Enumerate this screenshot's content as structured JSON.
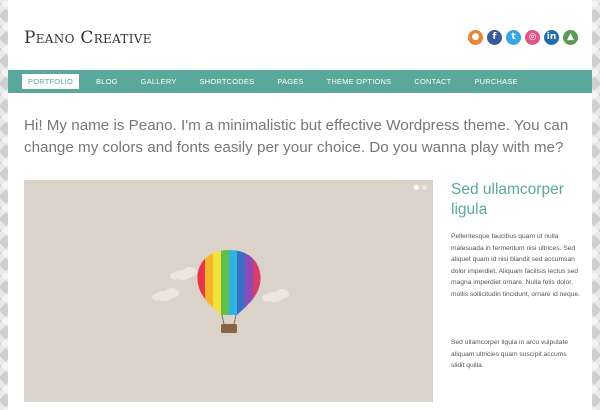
{
  "site": {
    "title": "Peano Creative"
  },
  "social": [
    {
      "icon": "rss-icon",
      "glyph": "●",
      "color": "#e8833a"
    },
    {
      "icon": "facebook-icon",
      "glyph": "f",
      "color": "#3b5998"
    },
    {
      "icon": "twitter-icon",
      "glyph": "t",
      "color": "#3aa7e0"
    },
    {
      "icon": "dribbble-icon",
      "glyph": "◎",
      "color": "#e2558c"
    },
    {
      "icon": "linkedin-icon",
      "glyph": "in",
      "color": "#1f6ea8"
    },
    {
      "icon": "forrst-icon",
      "glyph": "▲",
      "color": "#5a9a55"
    }
  ],
  "nav": {
    "items": [
      "Portfolio",
      "Blog",
      "Gallery",
      "Shortcodes",
      "Pages",
      "Theme Options",
      "Contact",
      "Purchase"
    ],
    "active_index": 0
  },
  "intro": "Hi! My name is Peano. I'm a minimalistic but effective Wordpress theme. You can change my colors and fonts easily per your choice. Do you wanna play with me?",
  "slider": {
    "slide_count": 2,
    "active_slide": 1
  },
  "sidebar": {
    "title": "Sed ullamcorper ligula",
    "p1": "Pellentesque faucibus quam ut nulla malesuada in fermentum nisi ultrices. Sed aliquet quam id nisi blandit sed accumsan dolor imperdiet. Aliquam facilisis lectus sed magna imperdiet ornare. Nulla felis dolor, mollis sollicitudin tincidunt, ornare id neque.",
    "p2": "Sed ullamcorper ligula in arcu vulputate aliquam ultricies quam suscipit accums slidit quilla."
  },
  "colors": {
    "accent": "#5aa89c",
    "slide_bg": "#dbd2ca",
    "text": "#777777"
  }
}
